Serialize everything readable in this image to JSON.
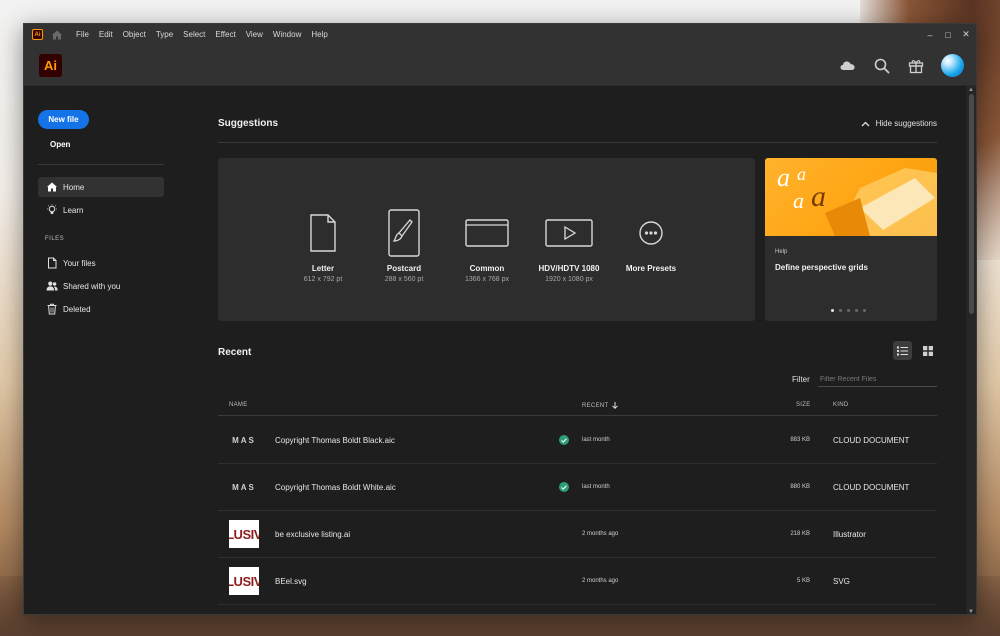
{
  "titlebar": {
    "logo": "Ai",
    "menu": [
      "File",
      "Edit",
      "Object",
      "Type",
      "Select",
      "Effect",
      "View",
      "Window",
      "Help"
    ]
  },
  "appbar": {
    "logo": "Ai",
    "icons": [
      "cloud-icon",
      "search-icon",
      "gift-icon",
      "avatar"
    ]
  },
  "sidebar": {
    "new_file": "New file",
    "open": "Open",
    "nav": [
      {
        "label": "Home",
        "icon": "home-icon",
        "active": true
      },
      {
        "label": "Learn",
        "icon": "lightbulb-icon",
        "active": false
      }
    ],
    "files_heading": "FILES",
    "files": [
      {
        "label": "Your files",
        "icon": "document-icon"
      },
      {
        "label": "Shared with you",
        "icon": "people-icon"
      },
      {
        "label": "Deleted",
        "icon": "trash-icon"
      }
    ]
  },
  "suggestions": {
    "title": "Suggestions",
    "hide_label": "Hide suggestions",
    "presets": [
      {
        "name": "Letter",
        "size": "612 x 792 pt",
        "icon": "letter-page-icon"
      },
      {
        "name": "Postcard",
        "size": "288 x 560 pt",
        "icon": "postcard-brush-icon"
      },
      {
        "name": "Common",
        "size": "1366 x 768 px",
        "icon": "browser-window-icon"
      },
      {
        "name": "HDV/HDTV 1080",
        "size": "1920 x 1080 px",
        "icon": "video-play-icon"
      },
      {
        "name": "More Presets",
        "size": "",
        "icon": "more-icon"
      }
    ],
    "help_card": {
      "label": "Help",
      "title": "Define perspective grids",
      "dots_total": 5,
      "dots_active": 0
    }
  },
  "recent": {
    "title": "Recent",
    "filter_label": "Filter",
    "filter_placeholder": "Filter Recent Files",
    "columns": {
      "name": "NAME",
      "recent": "RECENT",
      "size": "SIZE",
      "kind": "KIND"
    },
    "files": [
      {
        "thumb": "MAS",
        "thumb_style": "mas",
        "name": "Copyright Thomas Boldt Black.aic",
        "synced": true,
        "recent": "last month",
        "size": "883 KB",
        "kind": "CLOUD DOCUMENT"
      },
      {
        "thumb": "MAS",
        "thumb_style": "mas",
        "name": "Copyright Thomas Boldt White.aic",
        "synced": true,
        "recent": "last month",
        "size": "880 KB",
        "kind": "CLOUD DOCUMENT"
      },
      {
        "thumb": "LUSIV",
        "thumb_style": "lusiv",
        "name": "be exclusive listing.ai",
        "synced": false,
        "recent": "2 months ago",
        "size": "218 KB",
        "kind": "Illustrator"
      },
      {
        "thumb": "LUSIV",
        "thumb_style": "lusiv",
        "name": "BEel.svg",
        "synced": false,
        "recent": "2 months ago",
        "size": "5 KB",
        "kind": "SVG"
      }
    ]
  },
  "colors": {
    "accent": "#1473e6",
    "sync_ok": "#2d9d78",
    "app_logo_bg": "#330000",
    "app_logo_fg": "#ff9a00"
  }
}
